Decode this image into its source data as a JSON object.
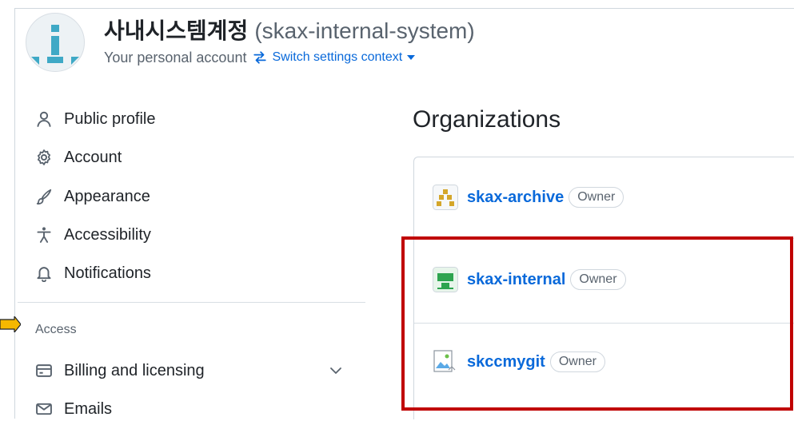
{
  "header": {
    "account_name": "사내시스템계정",
    "account_login": "(skax-internal-system)",
    "subtitle": "Your personal account",
    "switch_label": "Switch settings context"
  },
  "sidebar": {
    "items": [
      {
        "label": "Public profile",
        "icon": "person-icon"
      },
      {
        "label": "Account",
        "icon": "gear-icon"
      },
      {
        "label": "Appearance",
        "icon": "paintbrush-icon"
      },
      {
        "label": "Accessibility",
        "icon": "accessibility-icon"
      },
      {
        "label": "Notifications",
        "icon": "bell-icon"
      }
    ],
    "section_access": "Access",
    "access_items": [
      {
        "label": "Billing and licensing",
        "icon": "credit-card-icon"
      },
      {
        "label": "Emails",
        "icon": "mail-icon"
      }
    ]
  },
  "main": {
    "heading": "Organizations",
    "orgs": [
      {
        "name": "skax-archive",
        "role": "Owner"
      },
      {
        "name": "skax-internal",
        "role": "Owner"
      },
      {
        "name": "skccmygit",
        "role": "Owner"
      }
    ]
  },
  "colors": {
    "link": "#0969da",
    "highlight": "#c00000",
    "pointer": "#f5b800",
    "avatar_teal": "#3fa9c6"
  }
}
